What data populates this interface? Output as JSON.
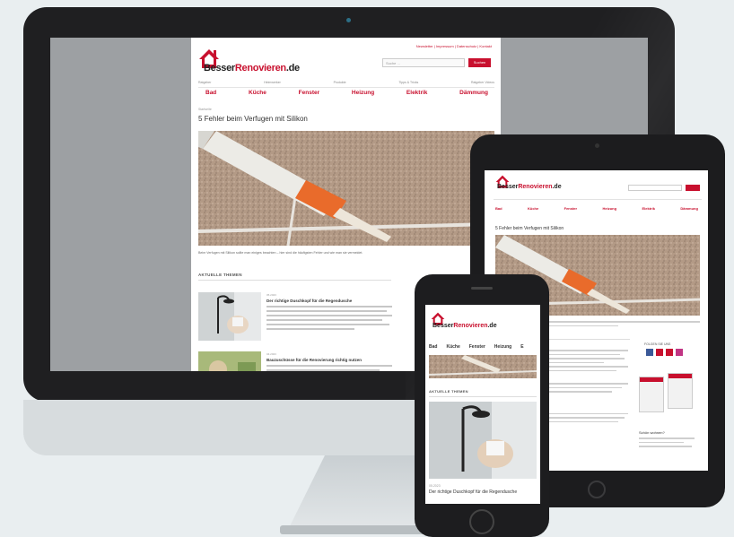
{
  "desktop": {
    "top_links": "Newsletter | Impressum | Datenschutz | Kontakt",
    "logo_prefix": "Besser",
    "logo_brand": "Renovieren",
    "logo_suffix": ".de",
    "search_placeholder": "Suche ...",
    "search_button": "Suchen",
    "subnav": [
      "Ratgeber",
      "Heimwerker",
      "Produkte",
      "Tipps & Tricks",
      "Ratgeber Videos"
    ],
    "nav": [
      "Bad",
      "Küche",
      "Fenster",
      "Heizung",
      "Elektrik",
      "Dämmung"
    ],
    "breadcrumb": "Startseite",
    "headline": "5 Fehler beim Verfugen mit Silikon",
    "caption": "Beim Verfugen mit Silikon sollte man einiges beachten – hier sind die häufigsten Fehler und wie man sie vermeidet.",
    "section_title": "AKTUELLE THEMEN",
    "articles": [
      {
        "date": "05.2023",
        "title": "Der richtige Duschkopf für die Regendusche"
      },
      {
        "date": "04.2023",
        "title": "Bauzuschüsse für die Renovierung richtig nutzen"
      }
    ]
  },
  "tablet": {
    "logo_prefix": "Besser",
    "logo_brand": "Renovieren",
    "logo_suffix": ".de",
    "headline": "5 Fehler beim Verfugen mit Silikon",
    "nav": [
      "Bad",
      "Küche",
      "Fenster",
      "Heizung",
      "Elektrik",
      "Dämmung"
    ],
    "social_title": "FOLGEN SIE UNS",
    "box_title": "Schön wohnen?"
  },
  "phone": {
    "logo_prefix": "Besser",
    "logo_brand": "Renovieren",
    "logo_suffix": ".de",
    "nav": [
      "Bad",
      "Küche",
      "Fenster",
      "Heizung",
      "E"
    ],
    "section_title": "AKTUELLE THEMEN",
    "date": "05.2023",
    "article_title": "Der richtige Duschkopf für die Regendusche"
  },
  "colors": {
    "brand_red": "#c8102e",
    "device_dark": "#1f1f21",
    "background": "#e9eef0"
  }
}
